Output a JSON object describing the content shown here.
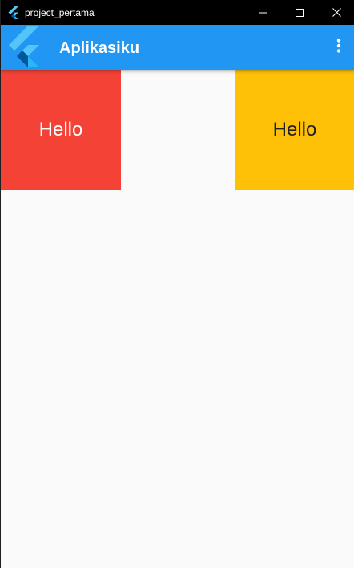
{
  "window": {
    "title": "project_pertama",
    "controls": {
      "minimize_icon": "minimize-icon",
      "maximize_icon": "maximize-icon",
      "close_icon": "close-icon"
    }
  },
  "appbar": {
    "title": "Aplikasiku",
    "logo_icon": "flutter-logo",
    "menu_icon": "more-vertical-icon",
    "color": "#2196f3"
  },
  "body": {
    "boxes": [
      {
        "label": "Hello",
        "color": "#f44336",
        "text_color": "#ffffff"
      },
      {
        "label": "Hello",
        "color": "#ffc107",
        "text_color": "#212121"
      }
    ],
    "background": "#fafafa"
  }
}
